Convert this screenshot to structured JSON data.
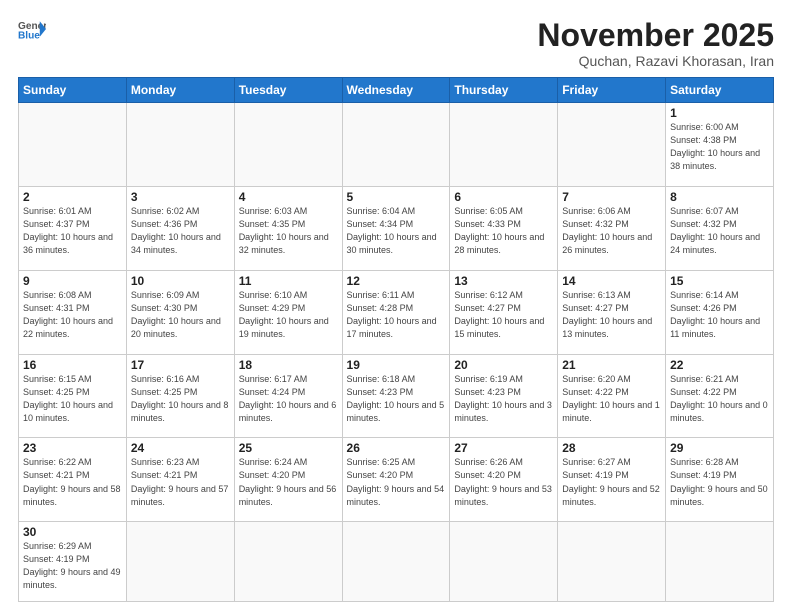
{
  "header": {
    "logo_general": "General",
    "logo_blue": "Blue",
    "month": "November 2025",
    "location": "Quchan, Razavi Khorasan, Iran"
  },
  "weekdays": [
    "Sunday",
    "Monday",
    "Tuesday",
    "Wednesday",
    "Thursday",
    "Friday",
    "Saturday"
  ],
  "days": {
    "1": "Sunrise: 6:00 AM\nSunset: 4:38 PM\nDaylight: 10 hours and 38 minutes.",
    "2": "Sunrise: 6:01 AM\nSunset: 4:37 PM\nDaylight: 10 hours and 36 minutes.",
    "3": "Sunrise: 6:02 AM\nSunset: 4:36 PM\nDaylight: 10 hours and 34 minutes.",
    "4": "Sunrise: 6:03 AM\nSunset: 4:35 PM\nDaylight: 10 hours and 32 minutes.",
    "5": "Sunrise: 6:04 AM\nSunset: 4:34 PM\nDaylight: 10 hours and 30 minutes.",
    "6": "Sunrise: 6:05 AM\nSunset: 4:33 PM\nDaylight: 10 hours and 28 minutes.",
    "7": "Sunrise: 6:06 AM\nSunset: 4:32 PM\nDaylight: 10 hours and 26 minutes.",
    "8": "Sunrise: 6:07 AM\nSunset: 4:32 PM\nDaylight: 10 hours and 24 minutes.",
    "9": "Sunrise: 6:08 AM\nSunset: 4:31 PM\nDaylight: 10 hours and 22 minutes.",
    "10": "Sunrise: 6:09 AM\nSunset: 4:30 PM\nDaylight: 10 hours and 20 minutes.",
    "11": "Sunrise: 6:10 AM\nSunset: 4:29 PM\nDaylight: 10 hours and 19 minutes.",
    "12": "Sunrise: 6:11 AM\nSunset: 4:28 PM\nDaylight: 10 hours and 17 minutes.",
    "13": "Sunrise: 6:12 AM\nSunset: 4:27 PM\nDaylight: 10 hours and 15 minutes.",
    "14": "Sunrise: 6:13 AM\nSunset: 4:27 PM\nDaylight: 10 hours and 13 minutes.",
    "15": "Sunrise: 6:14 AM\nSunset: 4:26 PM\nDaylight: 10 hours and 11 minutes.",
    "16": "Sunrise: 6:15 AM\nSunset: 4:25 PM\nDaylight: 10 hours and 10 minutes.",
    "17": "Sunrise: 6:16 AM\nSunset: 4:25 PM\nDaylight: 10 hours and 8 minutes.",
    "18": "Sunrise: 6:17 AM\nSunset: 4:24 PM\nDaylight: 10 hours and 6 minutes.",
    "19": "Sunrise: 6:18 AM\nSunset: 4:23 PM\nDaylight: 10 hours and 5 minutes.",
    "20": "Sunrise: 6:19 AM\nSunset: 4:23 PM\nDaylight: 10 hours and 3 minutes.",
    "21": "Sunrise: 6:20 AM\nSunset: 4:22 PM\nDaylight: 10 hours and 1 minute.",
    "22": "Sunrise: 6:21 AM\nSunset: 4:22 PM\nDaylight: 10 hours and 0 minutes.",
    "23": "Sunrise: 6:22 AM\nSunset: 4:21 PM\nDaylight: 9 hours and 58 minutes.",
    "24": "Sunrise: 6:23 AM\nSunset: 4:21 PM\nDaylight: 9 hours and 57 minutes.",
    "25": "Sunrise: 6:24 AM\nSunset: 4:20 PM\nDaylight: 9 hours and 56 minutes.",
    "26": "Sunrise: 6:25 AM\nSunset: 4:20 PM\nDaylight: 9 hours and 54 minutes.",
    "27": "Sunrise: 6:26 AM\nSunset: 4:20 PM\nDaylight: 9 hours and 53 minutes.",
    "28": "Sunrise: 6:27 AM\nSunset: 4:19 PM\nDaylight: 9 hours and 52 minutes.",
    "29": "Sunrise: 6:28 AM\nSunset: 4:19 PM\nDaylight: 9 hours and 50 minutes.",
    "30": "Sunrise: 6:29 AM\nSunset: 4:19 PM\nDaylight: 9 hours and 49 minutes."
  }
}
